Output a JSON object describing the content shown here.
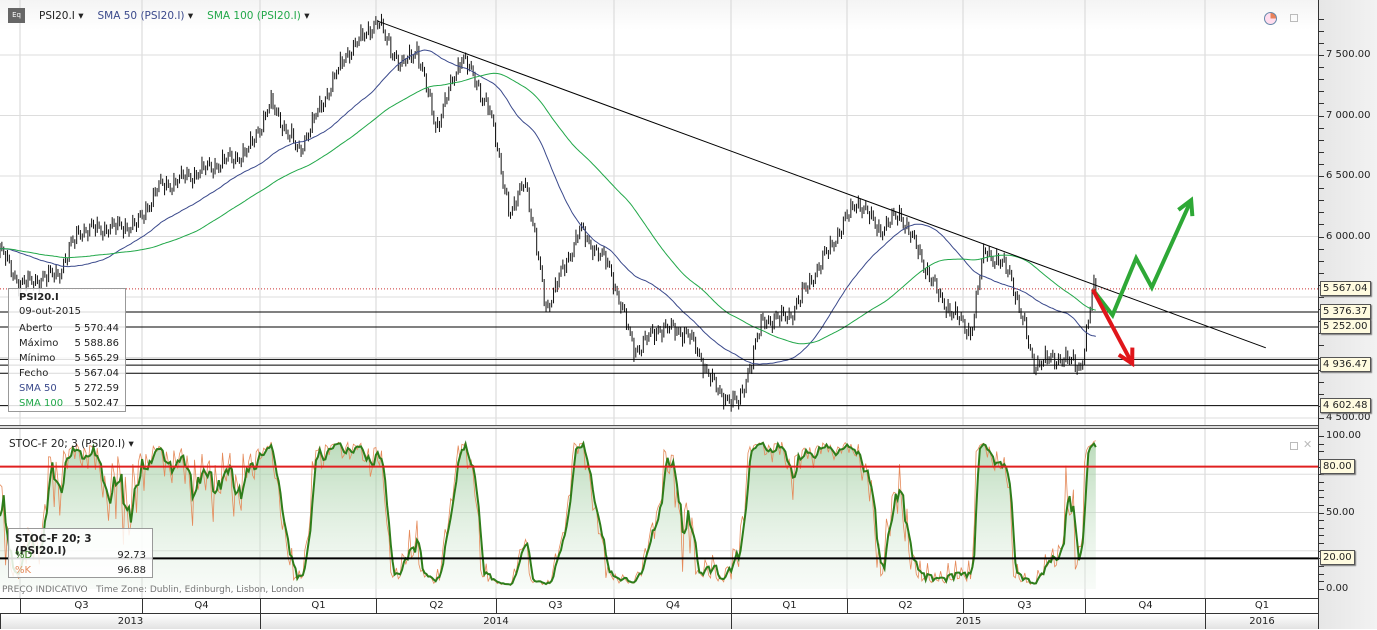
{
  "header": {
    "symbol": "PSI20.I",
    "sma50": "SMA 50 (PSI20.I)",
    "sma100": "SMA 100 (PSI20.I)",
    "stoch": "STOC-F 20; 3 (PSI20.I)"
  },
  "info_price": {
    "title": "PSI20.I",
    "date": "09-out-2015",
    "rows": [
      {
        "label": "Aberto",
        "value": "5 570.44"
      },
      {
        "label": "Máximo",
        "value": "5 588.86"
      },
      {
        "label": "Mínimo",
        "value": "5 565.29"
      },
      {
        "label": "Fecho",
        "value": "5 567.04"
      },
      {
        "label": "SMA 50",
        "value": "5 272.59"
      },
      {
        "label": "SMA 100",
        "value": "5 502.47"
      }
    ]
  },
  "info_stoch": {
    "title": "STOC-F 20; 3 (PSI20.I)",
    "rows": [
      {
        "label": "%D",
        "value": "92.73"
      },
      {
        "label": "%K",
        "value": "96.88"
      }
    ]
  },
  "footer": {
    "note": "PREÇO INDICATIVO",
    "timezone": "Time Zone: Dublin, Edinburgh, Lisbon, London"
  },
  "colors": {
    "price": "#000000",
    "sma50": "#3b4a8c",
    "sma100": "#22a84a",
    "stochD": "#2e7d1a",
    "stochK": "#e58a5a",
    "overbought": "#e02020",
    "up_arrow": "#2ea836",
    "down_arrow": "#e0161b"
  },
  "chart_data": [
    {
      "type": "line",
      "title": "PSI20.I",
      "ylim": [
        4450,
        7900
      ],
      "yticks": [
        "7 500.00",
        "7 000.00",
        "6 500.00",
        "6 000.00",
        "4 500.00"
      ],
      "x_unit": "months since Jul 2013",
      "close_keypoints": [
        [
          -0.5,
          5900
        ],
        [
          0,
          5600
        ],
        [
          1,
          5700
        ],
        [
          1.5,
          6050
        ],
        [
          3,
          6100
        ],
        [
          3.5,
          6400
        ],
        [
          5.8,
          6700
        ],
        [
          6.4,
          7100
        ],
        [
          7.1,
          6700
        ],
        [
          8.3,
          7500
        ],
        [
          9.1,
          7780
        ],
        [
          9.7,
          7400
        ],
        [
          10.1,
          7550
        ],
        [
          10.6,
          6900
        ],
        [
          11.25,
          7500
        ],
        [
          11.95,
          7050
        ],
        [
          12.5,
          6150
        ],
        [
          12.85,
          6500
        ],
        [
          13.4,
          5400
        ],
        [
          14.25,
          6050
        ],
        [
          15,
          5750
        ],
        [
          15.65,
          5050
        ],
        [
          16.3,
          5250
        ],
        [
          17,
          5200
        ],
        [
          17.8,
          4700
        ],
        [
          18.3,
          4620
        ],
        [
          18.9,
          5300
        ],
        [
          19.6,
          5350
        ],
        [
          20.6,
          5900
        ],
        [
          21.3,
          6300
        ],
        [
          21.9,
          6050
        ],
        [
          22.4,
          6200
        ],
        [
          23.4,
          5500
        ],
        [
          24.2,
          5200
        ],
        [
          24.55,
          5900
        ],
        [
          25.2,
          5700
        ],
        [
          25.8,
          4950
        ],
        [
          26.5,
          5000
        ],
        [
          27,
          4920
        ],
        [
          27.2,
          5300
        ],
        [
          27.3,
          5567
        ]
      ],
      "series": [
        {
          "name": "PSI20.I"
        },
        {
          "name": "SMA 50",
          "period": 50
        },
        {
          "name": "SMA 100",
          "period": 100
        }
      ],
      "levels": [
        {
          "value": 5567.04,
          "label": "5 567.04",
          "style": "dotted"
        },
        {
          "value": 5376.37,
          "label": "5 376.37"
        },
        {
          "value": 5252.0,
          "label": "5 252.00"
        },
        {
          "value": 4985
        },
        {
          "value": 4936.47,
          "label": "4 936.47"
        },
        {
          "value": 4870
        },
        {
          "value": 4602.48,
          "label": "4 602.48"
        }
      ],
      "trendline": [
        [
          9.1,
          7780
        ],
        [
          31.7,
          5080
        ]
      ],
      "annotations": [
        {
          "type": "arrow",
          "color": "green",
          "points": [
            [
              27.3,
              5560
            ],
            [
              27.8,
              5350
            ],
            [
              28.4,
              5820
            ],
            [
              28.8,
              5580
            ],
            [
              29.8,
              6300
            ]
          ]
        },
        {
          "type": "arrow",
          "color": "red",
          "points": [
            [
              27.3,
              5560
            ],
            [
              28.3,
              4950
            ]
          ]
        }
      ],
      "quarters": [
        "Q3",
        "Q4",
        "Q1",
        "Q2",
        "Q3",
        "Q4",
        "Q1",
        "Q2",
        "Q3",
        "Q4",
        "Q1"
      ],
      "years": [
        "2013",
        "2014",
        "2015",
        "2016"
      ]
    },
    {
      "type": "line",
      "title": "STOC-F 20; 3",
      "ylim": [
        -3,
        103
      ],
      "yticks": [
        "100.00",
        "50.00",
        "0.00"
      ],
      "bands": [
        {
          "value": 80,
          "label": "80.00"
        },
        {
          "value": 20,
          "label": "20.00"
        }
      ],
      "series": [
        {
          "name": "%D",
          "last": 92.73
        },
        {
          "name": "%K",
          "last": 96.88
        }
      ]
    }
  ]
}
